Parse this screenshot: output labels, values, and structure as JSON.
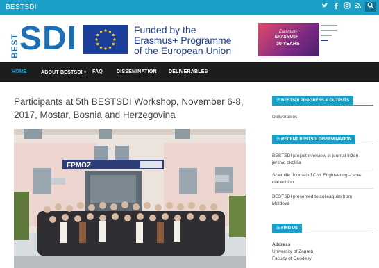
{
  "topbar": {
    "site_name": "BESTSDI",
    "social_icons": [
      "twitter-icon",
      "facebook-icon",
      "instagram-icon",
      "rss-icon",
      "search-icon"
    ],
    "color": "#1a9fc7"
  },
  "header": {
    "logo_best": "BEST",
    "logo_sdi": "SDI",
    "eu_text": [
      "Funded by the",
      "Erasmus+ Programme",
      "of the European Union"
    ],
    "erasmus_badge": {
      "line1": "Erasmus+",
      "line2": "ERASMUS+",
      "line3": "30 YEARS"
    }
  },
  "nav": {
    "items": [
      {
        "label": "HOME",
        "active": true
      },
      {
        "label": "ABOUT BESTSDI ▾",
        "active": false
      },
      {
        "label": "FAQ",
        "active": false
      },
      {
        "label": "DISSEMINATION",
        "active": false
      },
      {
        "label": "DELIVERABLES",
        "active": false
      }
    ]
  },
  "article": {
    "title": "Participants at 5th BESTSDI Workshop, November 6-8, 2017, Mostar, Bosnia and Herzegovina",
    "photo_sign": "FPMOZ"
  },
  "sidebar": {
    "progress": {
      "heading": "BESTSDI PROGRESS & OUTPUTS",
      "items": [
        "Deliverables"
      ]
    },
    "dissemination": {
      "heading": "RECENT BESTSDI DISSEMINATION",
      "items": [
        [
          "BESTSDI project overview in journal Inžen-",
          "jerstvo okoliša"
        ],
        [
          "Scientific Journal of Civil Engineering – spe-",
          "cial edition"
        ],
        [
          "BESTSDI presented to colleagues from",
          "Moldova"
        ]
      ]
    },
    "find_us": {
      "heading": "FIND US",
      "address_label": "Address",
      "address_lines": [
        "University of Zagreb",
        "Faculty of Geodesy"
      ]
    }
  }
}
